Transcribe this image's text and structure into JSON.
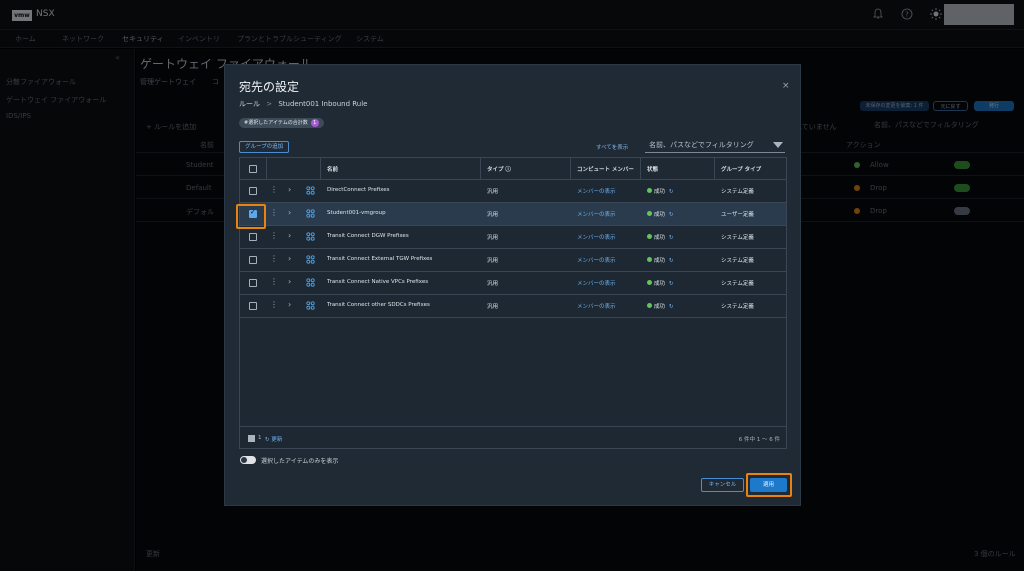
{
  "topbar": {
    "logo": "vmw",
    "app_name": "NSX"
  },
  "nav": [
    "ホーム",
    "ネットワーク",
    "セキュリティ",
    "インベントリ",
    "プランとトラブルシューティング",
    "システム"
  ],
  "sidebar": {
    "collapse": "«",
    "items": [
      "分散ファイアウォール",
      "ゲートウェイ ファイアウォール",
      "IDS/IPS"
    ]
  },
  "background": {
    "title": "ゲートウェイ ファイアウォール",
    "tabs": [
      "管理ゲートウェイ",
      "コ"
    ],
    "toolbar_add": "+ ルールを追加",
    "col_name": "名前",
    "col_action": "アクション",
    "filter_placeholder": "名前、パスなどでフィルタリング",
    "saved_text": "されていません",
    "pill_left": "未保存の変更を破棄: 1 件",
    "pill_mid": "元に戻す",
    "pill_right": "発行",
    "rows": [
      {
        "name": "Student",
        "ip": "e",
        "action": "Allow",
        "action_color": "#62c45a"
      },
      {
        "name": "Default",
        "ip": "e",
        "action": "Drop",
        "action_color": "#e8830f"
      },
      {
        "name": "デフォル",
        "ip": "",
        "action": "Drop",
        "action_color": "#e8830f"
      }
    ],
    "footer_refresh": "更新",
    "footer_count": "3 個のルール"
  },
  "modal": {
    "title": "宛先の設定",
    "close": "×",
    "breadcrumb_parent": "ルール",
    "breadcrumb_sep": ">",
    "breadcrumb_current": "Student001 Inbound Rule",
    "selected_chip": "#選択したアイテムの合計数",
    "selected_count": "1",
    "add_group_label": "グループの追加",
    "show_all_label": "すべてを表示",
    "filter_placeholder": "名前、パスなどでフィルタリング",
    "columns": {
      "name": "名前",
      "type": "タイプ ⓘ",
      "members": "コンピュート メンバー",
      "status": "状態",
      "group_type": "グループ タイプ"
    },
    "rows": [
      {
        "name": "DirectConnect Prefixes",
        "type": "汎用",
        "members": "メンバーの表示",
        "status": "成功",
        "group_type": "システム定義",
        "checked": false
      },
      {
        "name": "Student001-vmgroup",
        "type": "汎用",
        "members": "メンバーの表示",
        "status": "成功",
        "group_type": "ユーザー定義",
        "checked": true
      },
      {
        "name": "Transit Connect DGW Prefixes",
        "type": "汎用",
        "members": "メンバーの表示",
        "status": "成功",
        "group_type": "システム定義",
        "checked": false
      },
      {
        "name": "Transit Connect External TGW Prefixes",
        "type": "汎用",
        "members": "メンバーの表示",
        "status": "成功",
        "group_type": "システム定義",
        "checked": false
      },
      {
        "name": "Transit Connect Native VPCs Prefixes",
        "type": "汎用",
        "members": "メンバーの表示",
        "status": "成功",
        "group_type": "システム定義",
        "checked": false
      },
      {
        "name": "Transit Connect other SDDCs Prefixes",
        "type": "汎用",
        "members": "メンバーの表示",
        "status": "成功",
        "group_type": "システム定義",
        "checked": false
      }
    ],
    "footer": {
      "selected": "1",
      "refresh": "更新",
      "range": "6 件中 1 ～ 6 件"
    },
    "toggle_label": "選択したアイテムのみを表示",
    "cancel_label": "キャンセル",
    "apply_label": "適用"
  },
  "colors": {
    "accent": "#1d79c9",
    "highlight": "#e8830f",
    "success": "#62c45a"
  }
}
